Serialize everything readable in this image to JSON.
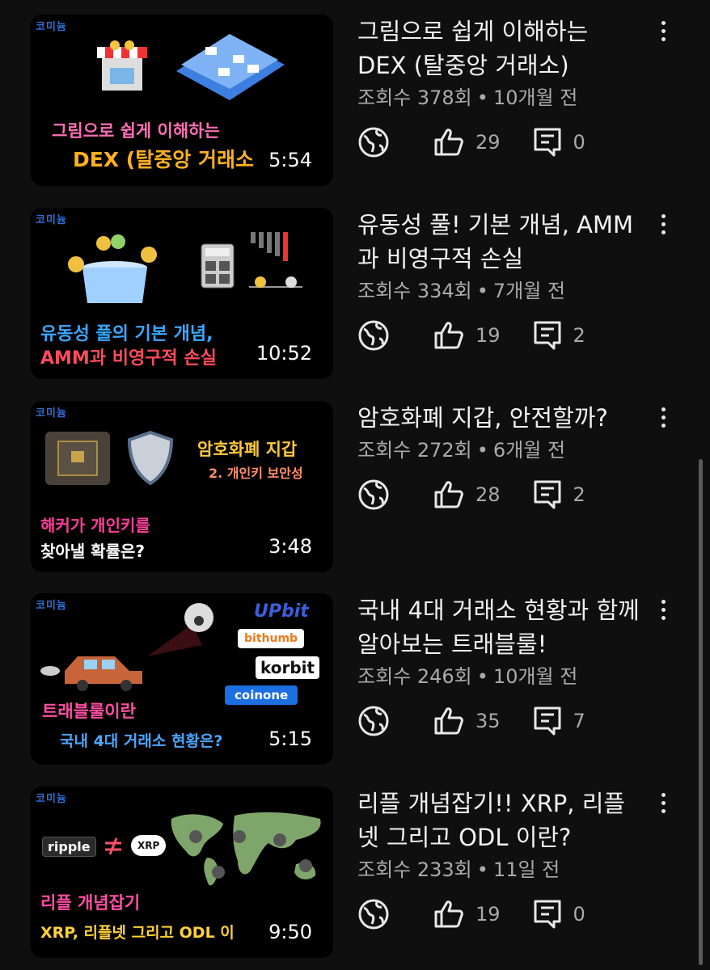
{
  "channel_logo": "코미늄",
  "videos": [
    {
      "thumb_lines": [
        {
          "text": "그림으로 쉽게 이해하는",
          "color": "#ff6fb5"
        },
        {
          "text": "DEX (탈중앙 거래소",
          "color": "#ffb020"
        }
      ],
      "duration": "5:54",
      "title": "그림으로 쉽게 이해하는 DEX (탈중앙 거래소)",
      "views": "조회수 378회",
      "age": "10개월 전",
      "likes": "29",
      "comments": "0"
    },
    {
      "thumb_lines": [
        {
          "text": "유동성 풀의 기본 개념,",
          "color": "#3aa8ff"
        },
        {
          "text": "AMM과 비영구적 손실",
          "color": "#ff4b5c"
        }
      ],
      "duration": "10:52",
      "title": "유동성 풀! 기본 개념, AMM과 비영구적 손실",
      "views": "조회수 334회",
      "age": "7개월 전",
      "likes": "19",
      "comments": "2"
    },
    {
      "thumb_lines": [
        {
          "text": "암호화폐 지갑",
          "color": "#ffc93a"
        },
        {
          "text": "2. 개인키 보안성",
          "color": "#ff8f6b"
        },
        {
          "text": "해커가 개인키를",
          "color": "#ff3d9a"
        },
        {
          "text": "찾아낼 확률은?",
          "color": "#ffffff"
        }
      ],
      "duration": "3:48",
      "title": "암호화폐 지갑, 안전할까?",
      "views": "조회수 272회",
      "age": "6개월 전",
      "likes": "28",
      "comments": "2"
    },
    {
      "thumb_lines": [
        {
          "text": "트래블룰이란",
          "color": "#ff4fa3"
        },
        {
          "text": "국내 4대 거래소 현황은?",
          "color": "#4aa6ff"
        }
      ],
      "brands": [
        "UPbit",
        "bithumb",
        "korbit",
        "coinone"
      ],
      "duration": "5:15",
      "title": "국내 4대 거래소 현황과 함께 알아보는 트래블룰!",
      "views": "조회수 246회",
      "age": "10개월 전",
      "likes": "35",
      "comments": "7"
    },
    {
      "thumb_lines": [
        {
          "text": "리플 개념잡기",
          "color": "#ff4fa3"
        },
        {
          "text": "XRP, 리플넷 그리고 ODL 이",
          "color": "#ffd23a"
        }
      ],
      "brands": [
        "ripple",
        "XRP"
      ],
      "duration": "9:50",
      "title": "리플 개념잡기!! XRP, 리플넷 그리고 ODL 이란?",
      "views": "조회수 233회",
      "age": "11일 전",
      "likes": "19",
      "comments": "0"
    }
  ],
  "separator": "•",
  "icons": [
    "globe-icon",
    "like-icon",
    "comment-icon",
    "more-vert-icon"
  ]
}
